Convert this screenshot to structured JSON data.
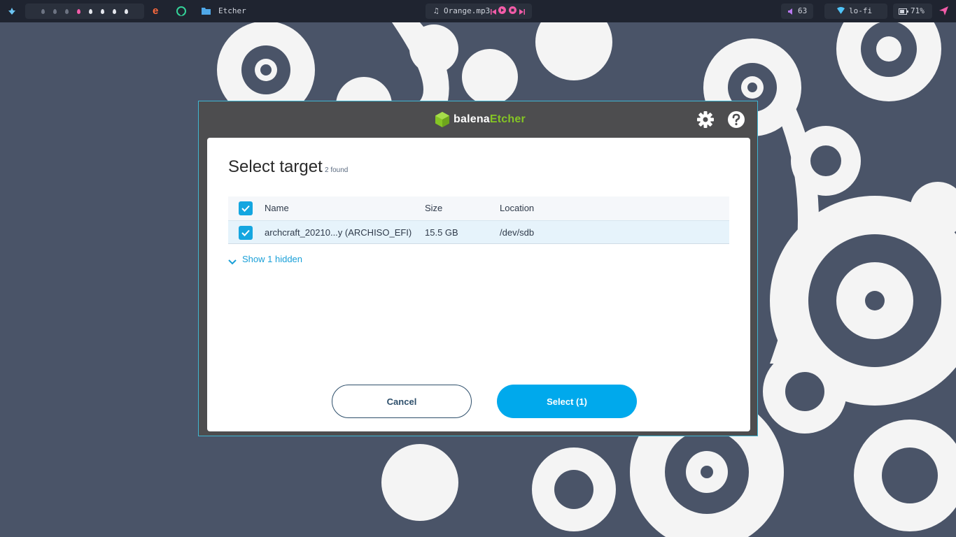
{
  "topbar": {
    "workspace_count": 8,
    "active_window": "Etcher",
    "media": {
      "track": "Orange.mp3"
    },
    "volume": "63",
    "network": "lo-fi",
    "battery": "71%"
  },
  "dialog": {
    "brand_primary": "balena",
    "brand_accent": "Etcher",
    "title": "Select target",
    "found": "2 found",
    "columns": {
      "name": "Name",
      "size": "Size",
      "location": "Location"
    },
    "drives": [
      {
        "name": "archcraft_20210...y (ARCHISO_EFI)",
        "size": "15.5 GB",
        "location": "/dev/sdb",
        "selected": true
      }
    ],
    "show_hidden": "Show 1 hidden",
    "cancel_label": "Cancel",
    "select_label": "Select (1)"
  },
  "colors": {
    "accent": "#00a9ec",
    "brand_green": "#85c524",
    "window_border": "#3fb6d3",
    "wallpaper": "#4a5468"
  }
}
